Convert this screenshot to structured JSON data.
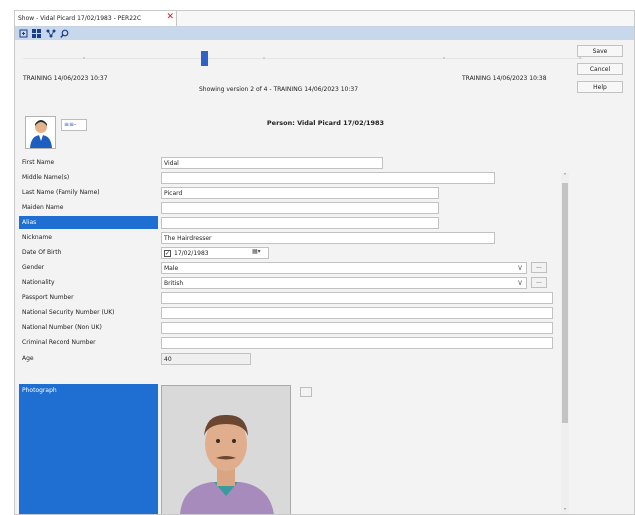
{
  "tab": {
    "title": "Show - Vidal Picard 17/02/1983 - PER22C",
    "close": "✕"
  },
  "toolbar": {
    "icons": [
      "expand-icon",
      "grid-icon",
      "network-icon",
      "search-icon"
    ]
  },
  "timeline": {
    "left_label": "TRAINING 14/06/2023 10:37",
    "right_label": "TRAINING 14/06/2023 10:38",
    "status": "Showing version 2 of 4 - TRAINING 14/06/2023 10:37"
  },
  "buttons": {
    "save": "Save",
    "cancel": "Cancel",
    "help": "Help"
  },
  "person": {
    "title": "Person: Vidal Picard 17/02/1983",
    "type_selector": "≡≡-"
  },
  "labels": {
    "first_name": "First Name",
    "middle_names": "Middle Name(s)",
    "last_name": "Last Name (Family Name)",
    "maiden_name": "Maiden Name",
    "alias": "Alias",
    "nickname": "Nickname",
    "dob": "Date Of Birth",
    "gender": "Gender",
    "nationality": "Nationality",
    "passport": "Passport Number",
    "nsn_uk": "National Security Number (UK)",
    "nn_non_uk": "National Number (Non UK)",
    "crn": "Criminal Record Number",
    "age": "Age",
    "photograph": "Photograph"
  },
  "values": {
    "first_name": "Vidal",
    "middle_names": "",
    "last_name": "Picard",
    "maiden_name": "",
    "alias": "",
    "nickname": "The Hairdresser",
    "dob": "17/02/1983",
    "gender": "Male",
    "nationality": "British",
    "passport": "",
    "nsn_uk": "",
    "nn_non_uk": "",
    "crn": "",
    "age": "40"
  },
  "glyphs": {
    "dropdown": "∨",
    "ellipsis": "...",
    "check": "✓",
    "scroll_up": "˄",
    "scroll_down": "˅",
    "calendar": "▦▾"
  },
  "colors": {
    "selected": "#1f6fd2",
    "toolbar": "#c7d7ec",
    "close": "#d21a1a"
  }
}
